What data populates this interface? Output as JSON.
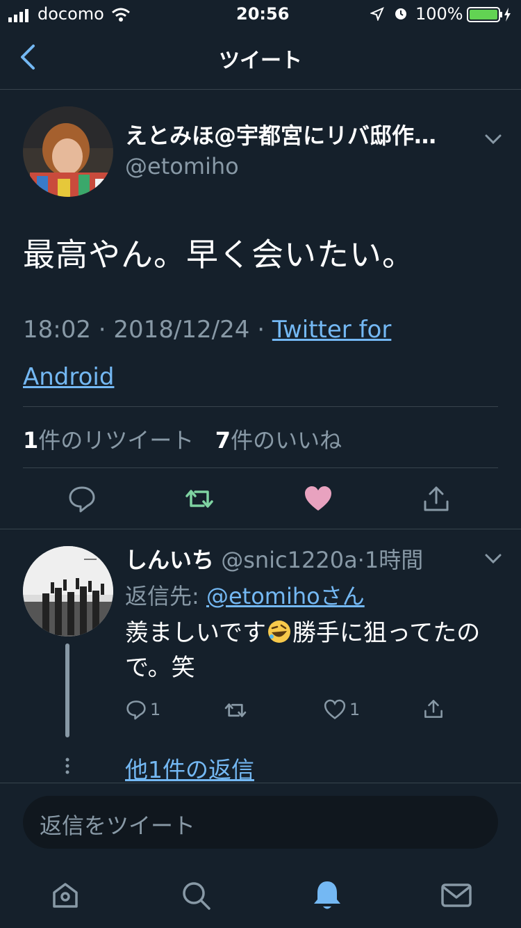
{
  "status_bar": {
    "carrier": "docomo",
    "time": "20:56",
    "battery": "100%"
  },
  "header": {
    "title": "ツイート"
  },
  "tweet": {
    "author_name": "えとみほ@宇都宮にリバ邸作…",
    "author_handle": "@etomiho",
    "text": "最高やん。早く会いたい。",
    "time": "18:02",
    "date": "2018/12/24",
    "source": "Twitter for Android",
    "retweet_count": "1",
    "retweet_label": "件のリツイート",
    "like_count": "7",
    "like_label": "件のいいね"
  },
  "reply": {
    "author_name": "しんいち",
    "author_handle": "@snic1220a",
    "separator": "·",
    "elapsed": "1時間",
    "reply_to_label": "返信先: ",
    "reply_to_handle": "@etomihoさん",
    "text_before_emoji": "羨ましいです",
    "text_after_emoji": "勝手に狙ってたので。笑",
    "reply_count": "1",
    "like_count": "1"
  },
  "more_replies": "他1件の返信",
  "compose": {
    "placeholder": "返信をツイート"
  },
  "colors": {
    "background": "#15202b",
    "accent": "#74b8f3",
    "retweet_active": "#7fd3a2",
    "like_active": "#e8a2bf",
    "battery": "#62d353"
  }
}
